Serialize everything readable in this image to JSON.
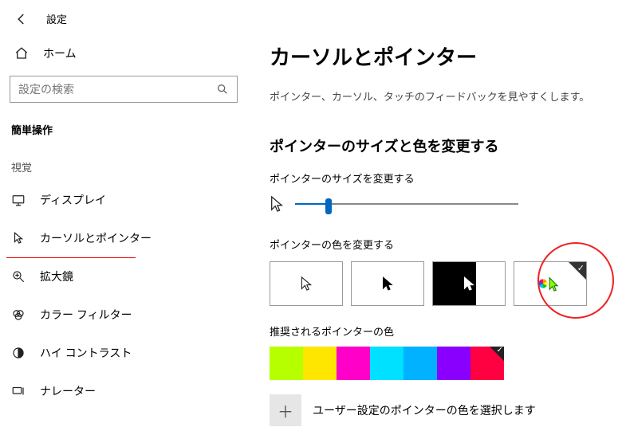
{
  "header": {
    "title": "設定",
    "home_label": "ホーム",
    "search_placeholder": "設定の検索"
  },
  "sidebar": {
    "group_label": "簡単操作",
    "vision_label": "視覚",
    "items": [
      {
        "icon": "display",
        "label": "ディスプレイ"
      },
      {
        "icon": "cursor",
        "label": "カーソルとポインター"
      },
      {
        "icon": "magnifier",
        "label": "拡大鏡"
      },
      {
        "icon": "filter",
        "label": "カラー フィルター"
      },
      {
        "icon": "contrast",
        "label": "ハイ コントラスト"
      },
      {
        "icon": "narrator",
        "label": "ナレーター"
      }
    ],
    "active_index": 1
  },
  "main": {
    "heading": "カーソルとポインター",
    "sub": "ポインター、カーソル、タッチのフィードバックを見やすくします。",
    "size_section_title": "ポインターのサイズと色を変更する",
    "size_label": "ポインターのサイズを変更する",
    "slider": {
      "value_pct": 15
    },
    "color_label": "ポインターの色を変更する",
    "color_options": [
      {
        "kind": "white",
        "selected": false
      },
      {
        "kind": "black",
        "selected": false
      },
      {
        "kind": "invert",
        "selected": false
      },
      {
        "kind": "custom",
        "selected": true
      }
    ],
    "recommended_label": "推奨されるポインターの色",
    "swatches": [
      {
        "hex": "#b6ff00",
        "selected": false
      },
      {
        "hex": "#ffe600",
        "selected": false
      },
      {
        "hex": "#ff00c8",
        "selected": false
      },
      {
        "hex": "#00e0ff",
        "selected": false
      },
      {
        "hex": "#00b2ff",
        "selected": false
      },
      {
        "hex": "#8a00ff",
        "selected": false
      },
      {
        "hex": "#ff0040",
        "selected": true
      }
    ],
    "custom_label": "ユーザー設定のポインターの色を選択します",
    "plus_glyph": "＋"
  },
  "annotation": {
    "highlight_option_index": 3
  }
}
